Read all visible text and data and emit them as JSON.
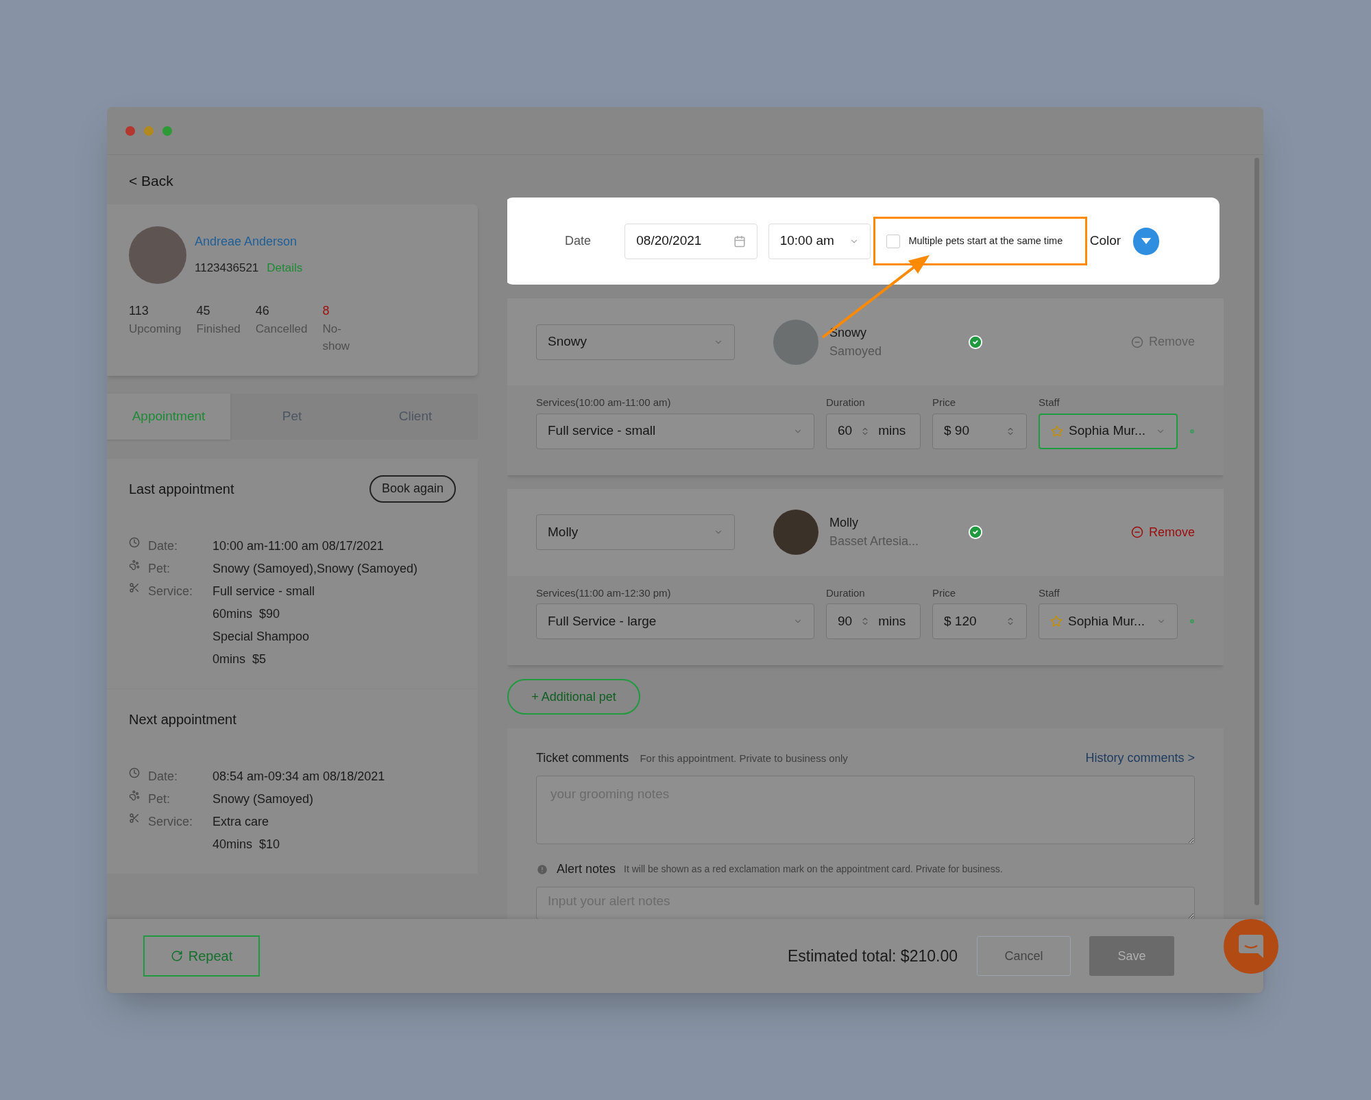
{
  "back": "< Back",
  "client": {
    "name": "Andreae Anderson",
    "phone": "1123436521",
    "details_link": "Details",
    "stats": [
      {
        "value": "113",
        "label": "Upcoming",
        "color": "#1f1f1f"
      },
      {
        "value": "45",
        "label": "Finished",
        "color": "#1f1f1f"
      },
      {
        "value": "46",
        "label": "Cancelled",
        "color": "#1f1f1f"
      },
      {
        "value": "8",
        "label": "No-show",
        "color": "#a01010"
      }
    ]
  },
  "tabs": [
    {
      "label": "Appointment",
      "selected": true
    },
    {
      "label": "Pet",
      "selected": false
    },
    {
      "label": "Client",
      "selected": false
    }
  ],
  "appointments": [
    {
      "title": "Last appointment",
      "button": "Book again",
      "rows": [
        {
          "kind": "date",
          "label": "Date:",
          "values": [
            "10:00 am-11:00 am 08/17/2021"
          ]
        },
        {
          "kind": "pet",
          "label": "Pet:",
          "values": [
            "Snowy (Samoyed),Snowy (Samoyed)"
          ]
        },
        {
          "kind": "service",
          "label": "Service:",
          "values": [
            "Full service - small",
            "60mins  $90",
            "Special Shampoo",
            "0mins  $5"
          ]
        }
      ]
    },
    {
      "title": "Next appointment",
      "rows": [
        {
          "kind": "date",
          "label": "Date:",
          "values": [
            "08:54 am-09:34 am 08/18/2021"
          ]
        },
        {
          "kind": "pet",
          "label": "Pet:",
          "values": [
            "Snowy (Samoyed)"
          ]
        },
        {
          "kind": "service",
          "label": "Service:",
          "values": [
            "Extra care",
            "40mins  $10"
          ]
        }
      ]
    }
  ],
  "schedule": {
    "date_label": "Date",
    "date": "08/20/2021",
    "time": "10:00 am",
    "multi_label": "Multiple pets start at the same time",
    "multi_checked": false,
    "color_label": "Color",
    "color": "#2f8ee0"
  },
  "pets": [
    {
      "select": "Snowy",
      "name": "Snowy",
      "breed": "Samoyed",
      "checked": true,
      "remove": "Remove",
      "remove_disabled": true,
      "services_label": "Services(10:00 am-11:00 am)",
      "service": "Full service - small",
      "duration_label": "Duration",
      "duration": "60",
      "unit": "mins",
      "price_label": "Price",
      "price": "$ 90",
      "staff_label": "Staff",
      "staff": "Sophia Mur...",
      "staff_focused": true
    },
    {
      "select": "Molly",
      "name": "Molly",
      "breed": "Basset Artesia...",
      "checked": true,
      "remove": "Remove",
      "remove_disabled": false,
      "services_label": "Services(11:00 am-12:30 pm)",
      "service": "Full Service - large",
      "duration_label": "Duration",
      "duration": "90",
      "unit": "mins",
      "price_label": "Price",
      "price": "$ 120",
      "staff_label": "Staff",
      "staff": "Sophia Mur...",
      "staff_focused": false
    }
  ],
  "additional_pet": "+ Additional pet",
  "comments": {
    "title": "Ticket comments",
    "hint": "For this appointment. Private to business only",
    "history_link": "History comments >",
    "placeholder": "your grooming notes",
    "alert_title": "Alert notes",
    "alert_hint": "It will be shown as a red exclamation mark on the appointment card. Private for business.",
    "alert_placeholder": "Input your alert notes"
  },
  "footer": {
    "repeat": "Repeat",
    "total": "Estimated total: $210.00",
    "cancel": "Cancel",
    "save": "Save"
  }
}
